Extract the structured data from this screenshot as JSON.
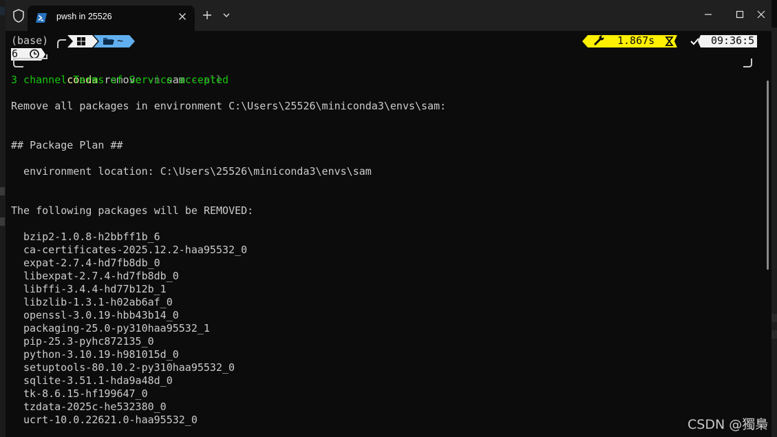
{
  "window": {
    "tab_title": "pwsh in 25526",
    "new_tab_symbol": "+",
    "close_tab_symbol": "×"
  },
  "prompt": {
    "env": "(base)",
    "dir": "~",
    "duration": "1.867s",
    "time_part1": "09:36:5",
    "time_part2": "6",
    "command_exe": "conda",
    "command_arg1": "remove",
    "command_flag": "-n",
    "command_arg2": "sam",
    "command_flag2": "--all"
  },
  "output": {
    "tos": "3 channel Terms of Service accepted",
    "remove_msg": "Remove all packages in environment C:\\Users\\25526\\miniconda3\\envs\\sam:",
    "plan_header": "## Package Plan ##",
    "env_location": "  environment location: C:\\Users\\25526\\miniconda3\\envs\\sam",
    "removed_header": "The following packages will be REMOVED:",
    "packages": [
      "bzip2-1.0.8-h2bbff1b_6",
      "ca-certificates-2025.12.2-haa95532_0",
      "expat-2.7.4-hd7fb8db_0",
      "libexpat-2.7.4-hd7fb8db_0",
      "libffi-3.4.4-hd77b12b_1",
      "libzlib-1.3.1-h02ab6af_0",
      "openssl-3.0.19-hbb43b14_0",
      "packaging-25.0-py310haa95532_1",
      "pip-25.3-pyhc872135_0",
      "python-3.10.19-h981015d_0",
      "setuptools-80.10.2-py310haa95532_0",
      "sqlite-3.51.1-hda9a48d_0",
      "tk-8.6.15-hf199647_0",
      "tzdata-2025c-he532380_0",
      "ucrt-10.0.22621.0-haa95532_0"
    ]
  },
  "watermark": "CSDN @獨梟",
  "colors": {
    "terminal_bg": "#0c0c0c",
    "titlebar_bg": "#202020",
    "green": "#16c60c",
    "yellow_segment": "#fff000",
    "blue_segment": "#61afef"
  }
}
